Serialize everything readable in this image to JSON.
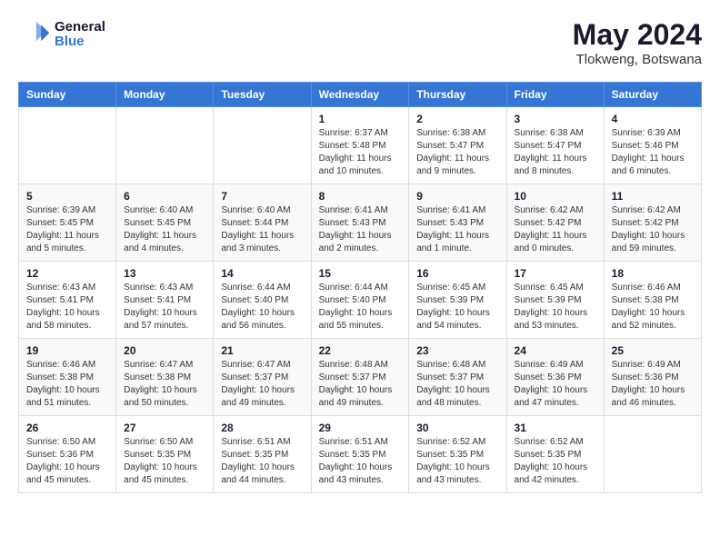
{
  "header": {
    "logo_line1": "General",
    "logo_line2": "Blue",
    "title": "May 2024",
    "subtitle": "Tlokweng, Botswana"
  },
  "calendar": {
    "days_of_week": [
      "Sunday",
      "Monday",
      "Tuesday",
      "Wednesday",
      "Thursday",
      "Friday",
      "Saturday"
    ],
    "weeks": [
      {
        "cells": [
          {
            "day": "",
            "info": ""
          },
          {
            "day": "",
            "info": ""
          },
          {
            "day": "",
            "info": ""
          },
          {
            "day": "1",
            "info": "Sunrise: 6:37 AM\nSunset: 5:48 PM\nDaylight: 11 hours\nand 10 minutes."
          },
          {
            "day": "2",
            "info": "Sunrise: 6:38 AM\nSunset: 5:47 PM\nDaylight: 11 hours\nand 9 minutes."
          },
          {
            "day": "3",
            "info": "Sunrise: 6:38 AM\nSunset: 5:47 PM\nDaylight: 11 hours\nand 8 minutes."
          },
          {
            "day": "4",
            "info": "Sunrise: 6:39 AM\nSunset: 5:46 PM\nDaylight: 11 hours\nand 6 minutes."
          }
        ]
      },
      {
        "cells": [
          {
            "day": "5",
            "info": "Sunrise: 6:39 AM\nSunset: 5:45 PM\nDaylight: 11 hours\nand 5 minutes."
          },
          {
            "day": "6",
            "info": "Sunrise: 6:40 AM\nSunset: 5:45 PM\nDaylight: 11 hours\nand 4 minutes."
          },
          {
            "day": "7",
            "info": "Sunrise: 6:40 AM\nSunset: 5:44 PM\nDaylight: 11 hours\nand 3 minutes."
          },
          {
            "day": "8",
            "info": "Sunrise: 6:41 AM\nSunset: 5:43 PM\nDaylight: 11 hours\nand 2 minutes."
          },
          {
            "day": "9",
            "info": "Sunrise: 6:41 AM\nSunset: 5:43 PM\nDaylight: 11 hours\nand 1 minute."
          },
          {
            "day": "10",
            "info": "Sunrise: 6:42 AM\nSunset: 5:42 PM\nDaylight: 11 hours\nand 0 minutes."
          },
          {
            "day": "11",
            "info": "Sunrise: 6:42 AM\nSunset: 5:42 PM\nDaylight: 10 hours\nand 59 minutes."
          }
        ]
      },
      {
        "cells": [
          {
            "day": "12",
            "info": "Sunrise: 6:43 AM\nSunset: 5:41 PM\nDaylight: 10 hours\nand 58 minutes."
          },
          {
            "day": "13",
            "info": "Sunrise: 6:43 AM\nSunset: 5:41 PM\nDaylight: 10 hours\nand 57 minutes."
          },
          {
            "day": "14",
            "info": "Sunrise: 6:44 AM\nSunset: 5:40 PM\nDaylight: 10 hours\nand 56 minutes."
          },
          {
            "day": "15",
            "info": "Sunrise: 6:44 AM\nSunset: 5:40 PM\nDaylight: 10 hours\nand 55 minutes."
          },
          {
            "day": "16",
            "info": "Sunrise: 6:45 AM\nSunset: 5:39 PM\nDaylight: 10 hours\nand 54 minutes."
          },
          {
            "day": "17",
            "info": "Sunrise: 6:45 AM\nSunset: 5:39 PM\nDaylight: 10 hours\nand 53 minutes."
          },
          {
            "day": "18",
            "info": "Sunrise: 6:46 AM\nSunset: 5:38 PM\nDaylight: 10 hours\nand 52 minutes."
          }
        ]
      },
      {
        "cells": [
          {
            "day": "19",
            "info": "Sunrise: 6:46 AM\nSunset: 5:38 PM\nDaylight: 10 hours\nand 51 minutes."
          },
          {
            "day": "20",
            "info": "Sunrise: 6:47 AM\nSunset: 5:38 PM\nDaylight: 10 hours\nand 50 minutes."
          },
          {
            "day": "21",
            "info": "Sunrise: 6:47 AM\nSunset: 5:37 PM\nDaylight: 10 hours\nand 49 minutes."
          },
          {
            "day": "22",
            "info": "Sunrise: 6:48 AM\nSunset: 5:37 PM\nDaylight: 10 hours\nand 49 minutes."
          },
          {
            "day": "23",
            "info": "Sunrise: 6:48 AM\nSunset: 5:37 PM\nDaylight: 10 hours\nand 48 minutes."
          },
          {
            "day": "24",
            "info": "Sunrise: 6:49 AM\nSunset: 5:36 PM\nDaylight: 10 hours\nand 47 minutes."
          },
          {
            "day": "25",
            "info": "Sunrise: 6:49 AM\nSunset: 5:36 PM\nDaylight: 10 hours\nand 46 minutes."
          }
        ]
      },
      {
        "cells": [
          {
            "day": "26",
            "info": "Sunrise: 6:50 AM\nSunset: 5:36 PM\nDaylight: 10 hours\nand 45 minutes."
          },
          {
            "day": "27",
            "info": "Sunrise: 6:50 AM\nSunset: 5:35 PM\nDaylight: 10 hours\nand 45 minutes."
          },
          {
            "day": "28",
            "info": "Sunrise: 6:51 AM\nSunset: 5:35 PM\nDaylight: 10 hours\nand 44 minutes."
          },
          {
            "day": "29",
            "info": "Sunrise: 6:51 AM\nSunset: 5:35 PM\nDaylight: 10 hours\nand 43 minutes."
          },
          {
            "day": "30",
            "info": "Sunrise: 6:52 AM\nSunset: 5:35 PM\nDaylight: 10 hours\nand 43 minutes."
          },
          {
            "day": "31",
            "info": "Sunrise: 6:52 AM\nSunset: 5:35 PM\nDaylight: 10 hours\nand 42 minutes."
          },
          {
            "day": "",
            "info": ""
          }
        ]
      }
    ]
  }
}
